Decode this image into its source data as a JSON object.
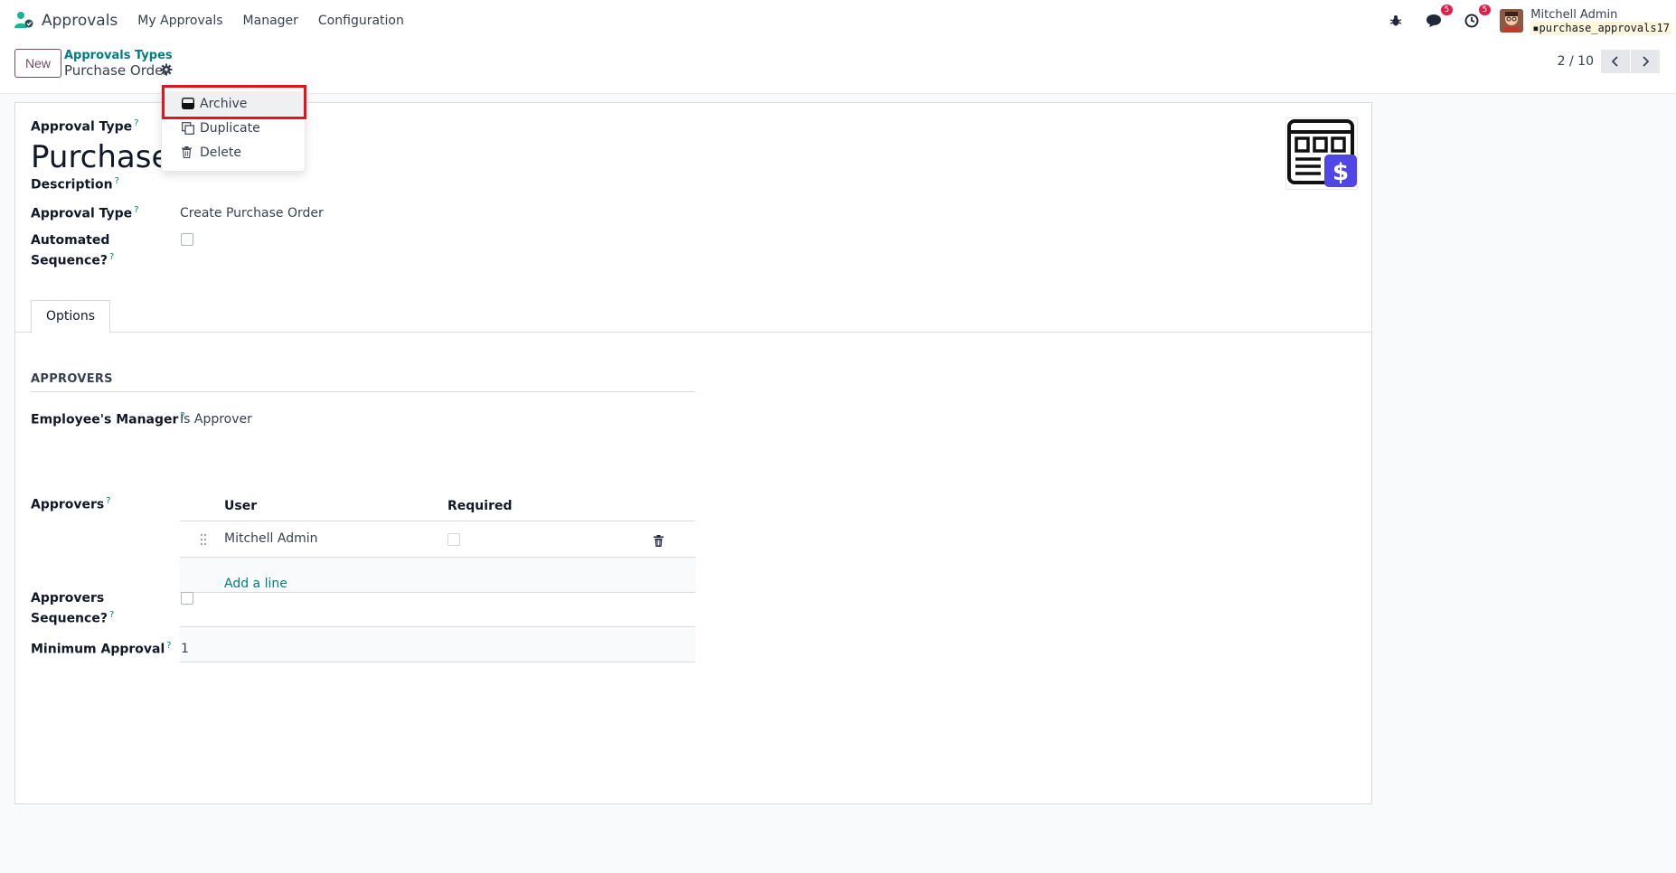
{
  "navbar": {
    "app_name": "Approvals",
    "menu": [
      "My Approvals",
      "Manager",
      "Configuration"
    ],
    "messages_badge": "5",
    "activities_badge": "5",
    "user_name": "Mitchell Admin",
    "database": "purchase_approvals17"
  },
  "control_panel": {
    "new_label": "New",
    "breadcrumb_parent": "Approvals Types",
    "breadcrumb_current": "Purchase Order",
    "pager": "2 / 10"
  },
  "dropdown": {
    "items": [
      "Archive",
      "Duplicate",
      "Delete"
    ]
  },
  "form": {
    "approval_type_label": "Approval Type",
    "title": "Purchase Order",
    "description_label": "Description",
    "approval_type2_label": "Approval Type",
    "approval_type2_value": "Create Purchase Order",
    "automated_seq_label_1": "Automated",
    "automated_seq_label_2": "Sequence?",
    "tab_options": "Options",
    "approvers_section": "APPROVERS",
    "employees_manager_label": "Employee's Manager",
    "employees_manager_value": "Is Approver",
    "approvers_label": "Approvers",
    "table": {
      "col_user": "User",
      "col_required": "Required",
      "rows": [
        {
          "user": "Mitchell Admin",
          "required": false
        }
      ],
      "add_line": "Add a line"
    },
    "approvers_seq_label_1": "Approvers",
    "approvers_seq_label_2": "Sequence?",
    "minimum_approval_label": "Minimum Approval",
    "minimum_approval_value": "1",
    "help_mark": "?"
  },
  "colors": {
    "brand": "#714b67",
    "link": "#017e84",
    "badge": "#e11d48",
    "highlight": "#e5141b"
  }
}
